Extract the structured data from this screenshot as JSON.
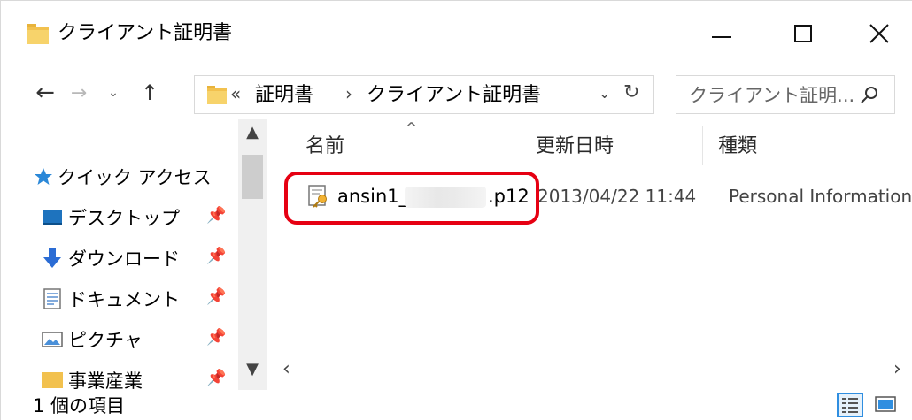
{
  "window": {
    "title": "クライアント証明書",
    "minimize_label": "minimize",
    "maximize_label": "maximize",
    "close_label": "close"
  },
  "nav": {
    "back_glyph": "←",
    "forward_glyph": "→",
    "recent_glyph": "⌄",
    "up_glyph": "↑"
  },
  "address": {
    "overflow": "«",
    "segments": [
      "証明書",
      "クライアント証明書"
    ],
    "separator": "›",
    "dropdown_glyph": "⌄",
    "refresh_glyph": "↻"
  },
  "search": {
    "placeholder": "クライアント証明..."
  },
  "navpane": {
    "items": [
      {
        "label": "クイック アクセス",
        "icon": "star-icon",
        "pinned": false
      },
      {
        "label": "デスクトップ",
        "icon": "desktop-icon",
        "pinned": true
      },
      {
        "label": "ダウンロード",
        "icon": "download-icon",
        "pinned": true
      },
      {
        "label": "ドキュメント",
        "icon": "document-icon",
        "pinned": true
      },
      {
        "label": "ピクチャ",
        "icon": "picture-icon",
        "pinned": true
      },
      {
        "label": "事業産業",
        "icon": "folder-icon",
        "pinned": true
      }
    ],
    "pin_glyph": "✦"
  },
  "columns": {
    "name": "名前",
    "date": "更新日時",
    "type": "種類"
  },
  "files": [
    {
      "name_prefix": "ansin1_",
      "name_suffix": ".p12",
      "modified": "2013/04/22 11:44",
      "type": "Personal Information"
    }
  ],
  "status": {
    "count": "1 個の項目"
  },
  "colors": {
    "folder": "#f2c14e",
    "highlight": "#e60012",
    "accent": "#2f8ee0"
  }
}
